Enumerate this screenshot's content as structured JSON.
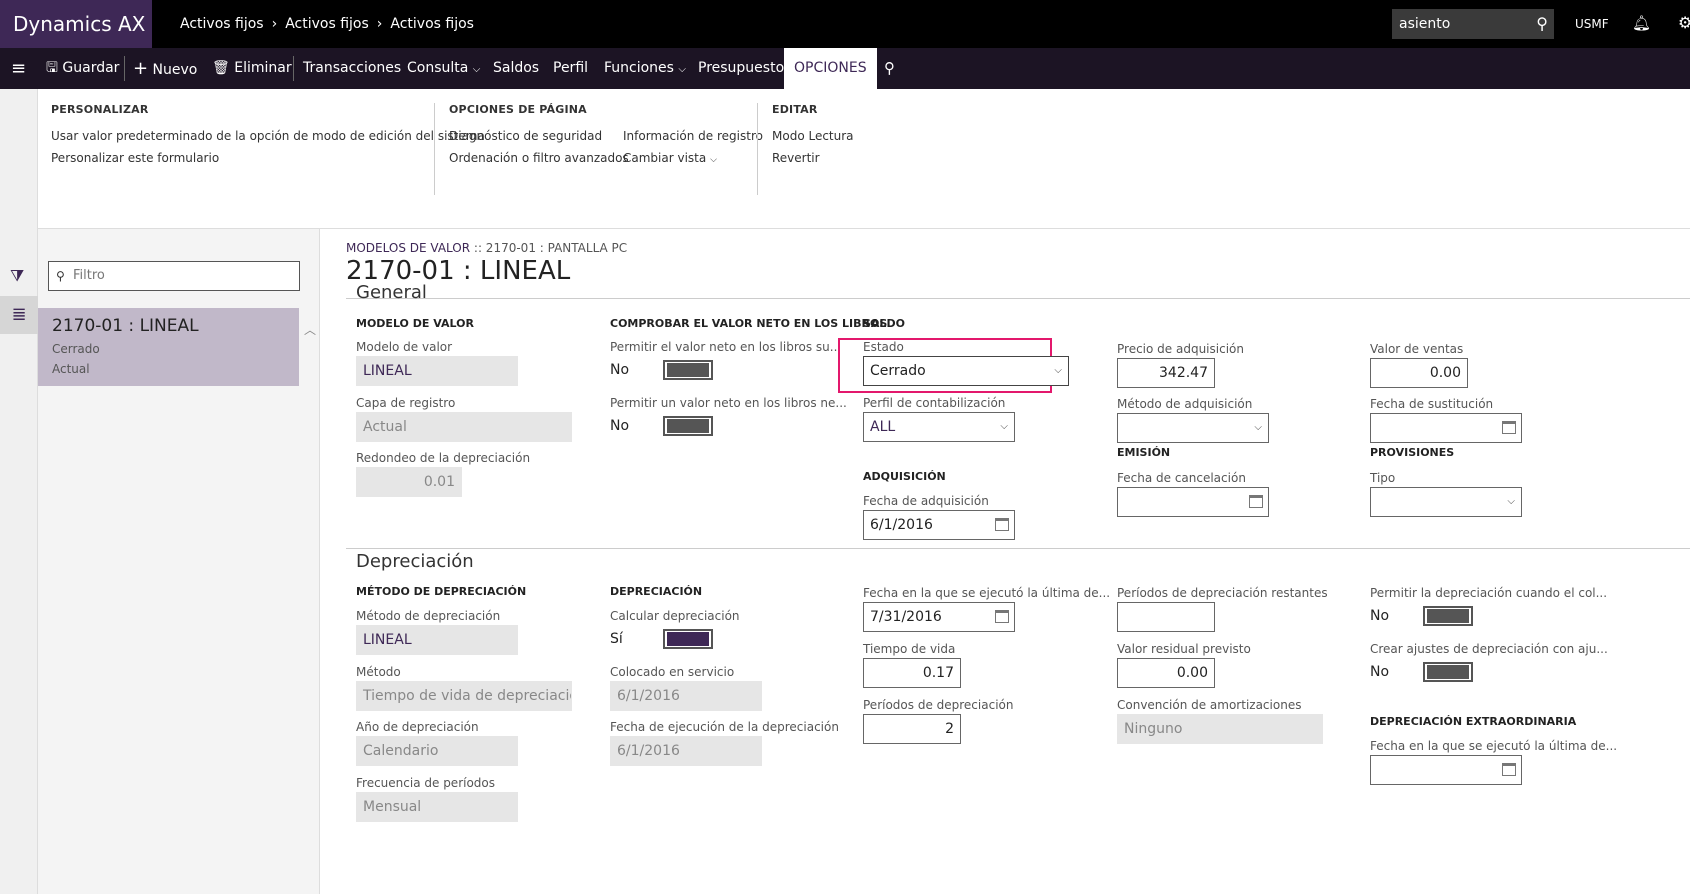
{
  "app": {
    "title": "Dynamics AX"
  },
  "breadcrumb": [
    "Activos fijos",
    "Activos fijos",
    "Activos fijos"
  ],
  "top_search": {
    "value": "asiento"
  },
  "company": "USMF",
  "actionbar": {
    "save": "Guardar",
    "new": "Nuevo",
    "delete": "Eliminar",
    "transactions": "Transacciones",
    "query": "Consulta",
    "balances": "Saldos",
    "profile": "Perfil",
    "functions": "Funciones",
    "budget": "Presupuesto",
    "options": "OPCIONES"
  },
  "ribbon": {
    "personalize": {
      "title": "PERSONALIZAR",
      "items": [
        "Usar valor predeterminado de la opción de modo de edición del sistema",
        "Personalizar este formulario"
      ]
    },
    "page_options": {
      "title": "OPCIONES DE PÁGINA",
      "col1": [
        "Diagnóstico de seguridad",
        "Ordenación o filtro avanzados"
      ],
      "col2": [
        "Información de registro",
        "Cambiar vista"
      ]
    },
    "edit": {
      "title": "EDITAR",
      "items": [
        "Modo Lectura",
        "Revertir"
      ]
    }
  },
  "list": {
    "filter_placeholder": "Filtro",
    "record": {
      "title": "2170-01 : LINEAL",
      "line1": "Cerrado",
      "line2": "Actual"
    }
  },
  "header": {
    "caption_link": "MODELOS DE VALOR",
    "caption_rest": " :: 2170-01 : PANTALLA PC",
    "title": "2170-01 : LINEAL"
  },
  "general": {
    "tab": "General",
    "value_model": {
      "title": "MODELO DE VALOR",
      "model_label": "Modelo de valor",
      "model": "LINEAL",
      "layer_label": "Capa de registro",
      "layer": "Actual",
      "rounding_label": "Redondeo de la depreciación",
      "rounding": "0.01"
    },
    "netbook": {
      "title": "COMPROBAR EL VALOR NETO EN LOS LIBROS",
      "allow1_label": "Permitir el valor neto en los libros su...",
      "allow1": "No",
      "allow2_label": "Permitir un valor neto en los libros ne...",
      "allow2": "No"
    },
    "balance": {
      "title": "SALDO",
      "status_label": "Estado",
      "status": "Cerrado",
      "posting_label": "Perfil de contabilización",
      "posting": "ALL"
    },
    "acquisition": {
      "title": "ADQUISICIÓN",
      "date_label": "Fecha de adquisición",
      "date": "6/1/2016"
    },
    "prices": {
      "price_label": "Precio de adquisición",
      "price": "342.47",
      "method_label": "Método de adquisición",
      "method": ""
    },
    "emission": {
      "title": "EMISIÓN",
      "cancel_label": "Fecha de cancelación",
      "cancel": ""
    },
    "sales": {
      "sales_label": "Valor de ventas",
      "sales": "0.00",
      "replace_label": "Fecha de sustitución",
      "replace": ""
    },
    "provisions": {
      "title": "PROVISIONES",
      "type_label": "Tipo",
      "type": ""
    }
  },
  "depreciation": {
    "tab": "Depreciación",
    "method_group": {
      "title": "MÉTODO DE DEPRECIACIÓN",
      "method_label": "Método de depreciación",
      "method": "LINEAL",
      "calc_label": "Método",
      "calc": "Tiempo de vida de depreciación...",
      "year_label": "Año de depreciación",
      "year": "Calendario",
      "freq_label": "Frecuencia de períodos",
      "freq": "Mensual"
    },
    "dep_group": {
      "title": "DEPRECIACIÓN",
      "calc_label": "Calcular depreciación",
      "calc": "Sí",
      "service_label": "Colocado en servicio",
      "service": "6/1/2016",
      "run_label": "Fecha de ejecución de la depreciación",
      "run": "6/1/2016"
    },
    "col3": {
      "last_label": "Fecha en la que se ejecutó la última de...",
      "last": "7/31/2016",
      "life_label": "Tiempo de vida",
      "life": "0.17",
      "periods_label": "Períodos de depreciación",
      "periods": "2"
    },
    "col4": {
      "remaining_label": "Períodos de depreciación restantes",
      "remaining": "",
      "residual_label": "Valor residual previsto",
      "residual": "0.00",
      "convention_label": "Convención de amortizaciones",
      "convention": "Ninguno"
    },
    "col5": {
      "allow_label": "Permitir la depreciación cuando el col...",
      "allow": "No",
      "adjust_label": "Crear ajustes de depreciación con aju...",
      "adjust": "No",
      "extra_title": "DEPRECIACIÓN EXTRAORDINARIA",
      "extra_label": "Fecha en la que se ejecutó la última de...",
      "extra": ""
    }
  }
}
